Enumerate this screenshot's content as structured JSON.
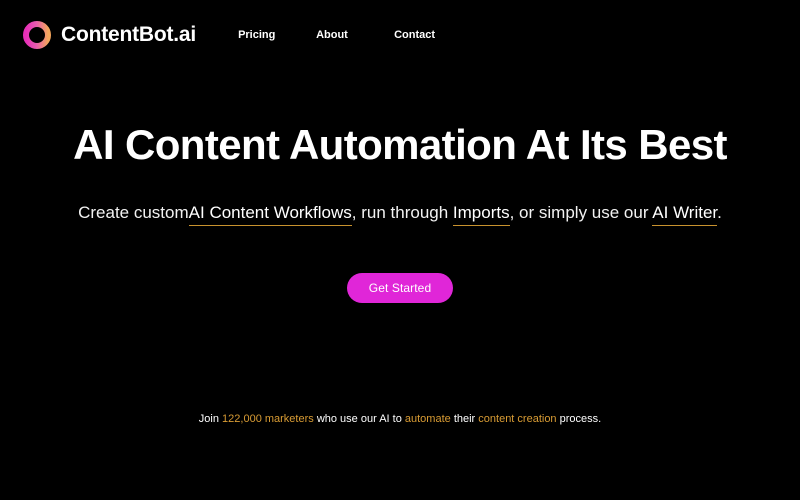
{
  "page": {
    "background_color": "#000000",
    "accent_magenta": "#e026d8",
    "accent_amber": "#d99c34",
    "underline_color": "#c8922e",
    "text_color": "#ffffff"
  },
  "navbar": {
    "logo_icon": "contentbot-ring-logo-icon",
    "logo_gradient_from": "#e040c8",
    "logo_gradient_to": "#f0a050",
    "brand_name": "ContentBot.ai",
    "links": [
      {
        "label": "Pricing"
      },
      {
        "label": "About"
      },
      {
        "label": "Contact"
      }
    ]
  },
  "hero": {
    "title": "AI Content Automation At Its Best",
    "subtitle": {
      "part1": "Create custom",
      "link1": "AI Content Workflows",
      "part2": ", run through ",
      "link2": "Imports",
      "part3": ", or simply use our ",
      "link3": "AI Writer",
      "part4": "."
    },
    "cta_label": "Get Started"
  },
  "social_proof": {
    "part1": "Join ",
    "count": "122,000 marketers",
    "part2": " who use our AI to ",
    "highlight1": "automate",
    "part3": " their ",
    "highlight2": "content creation",
    "part4": " process."
  }
}
